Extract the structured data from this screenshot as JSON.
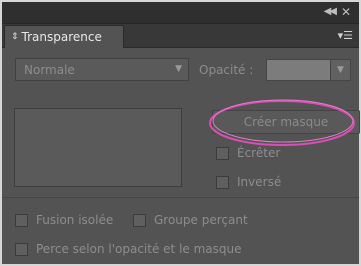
{
  "panel": {
    "tab_label": "Transparence",
    "tab_icon": "up-down-arrows-icon",
    "collapse_icon": "double-chevron-left-icon",
    "close_icon": "close-icon",
    "menu_icon": "panel-menu-icon"
  },
  "blend_mode": {
    "selected": "Normale"
  },
  "opacity": {
    "label": "Opacité :",
    "value": ""
  },
  "mask": {
    "create_label": "Créer masque",
    "clip_label": "Écrêter",
    "invert_label": "Inversé"
  },
  "options": {
    "isolate_label": "Fusion isolée",
    "knockout_label": "Groupe perçant",
    "knockout_opacity_label": "Perce selon l'opacité et le masque"
  },
  "colors": {
    "highlight": "#d94fb5",
    "panel_bg": "#535353"
  }
}
